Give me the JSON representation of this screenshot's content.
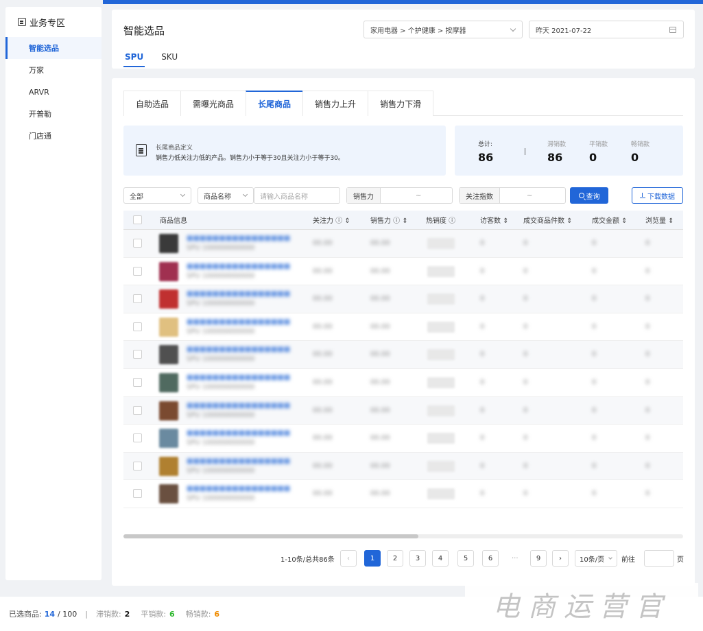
{
  "sidebar": {
    "title": "业务专区",
    "items": [
      {
        "label": "智能选品",
        "active": true
      },
      {
        "label": "万家",
        "active": false
      },
      {
        "label": "ARVR",
        "active": false
      },
      {
        "label": "开普勒",
        "active": false
      },
      {
        "label": "门店通",
        "active": false
      }
    ]
  },
  "header": {
    "title": "智能选品",
    "category": "家用电器 > 个护健康 > 按摩器",
    "date": "昨天 2021-07-22",
    "tabs": [
      "SPU",
      "SKU"
    ],
    "active_tab": "SPU"
  },
  "main": {
    "tabs": [
      "自助选品",
      "需曝光商品",
      "长尾商品",
      "销售力上升",
      "销售力下滑"
    ],
    "active_tab": "长尾商品",
    "info": {
      "title": "长尾商品定义",
      "desc": "销售力低关注力低的产品。销售力小于等于30且关注力小于等于30。"
    },
    "stats": {
      "total_label": "总计:",
      "total": "86",
      "stagnant_label": "滞销款",
      "stagnant": "86",
      "flat_label": "平销款",
      "flat": "0",
      "hot_label": "畅销款",
      "hot": "0"
    },
    "filters": {
      "scope": "全部",
      "field": "商品名称",
      "name_placeholder": "请输入商品名称",
      "sales_label": "销售力",
      "range_sep": "~",
      "attention_label": "关注指数",
      "query": "查询",
      "download": "下载数据"
    },
    "table": {
      "columns": [
        "商品信息",
        "关注力 ⓘ ⇕",
        "销售力 ⓘ ⇕",
        "热销度 ⓘ",
        "访客数 ⇕",
        "成交商品件数 ⇕",
        "成交金额 ⇕",
        "浏览量 ⇕"
      ],
      "rows": [
        {
          "name": "■■■■■■■■■■■■■■■■",
          "spu": "SPU 100000000000",
          "att": "00.00",
          "sales": "00.00",
          "heat": "■■■",
          "uv": "0",
          "qty": "0",
          "amt": "0",
          "pv": "0",
          "thumb": "#3a3a3a"
        },
        {
          "name": "■■■■■■■■■■■■■■■■",
          "spu": "SPU 100000000000",
          "att": "00.00",
          "sales": "00.00",
          "heat": "■■■",
          "uv": "0",
          "qty": "0",
          "amt": "0",
          "pv": "0",
          "thumb": "#a03050"
        },
        {
          "name": "■■■■■■■■■■■■■■■■",
          "spu": "SPU 100000000000",
          "att": "00.00",
          "sales": "00.00",
          "heat": "■■■",
          "uv": "0",
          "qty": "0",
          "amt": "0",
          "pv": "0",
          "thumb": "#c03030"
        },
        {
          "name": "■■■■■■■■■■■■■■■■",
          "spu": "SPU 100000000000",
          "att": "00.00",
          "sales": "00.00",
          "heat": "■■■",
          "uv": "0",
          "qty": "0",
          "amt": "0",
          "pv": "0",
          "thumb": "#e0c080"
        },
        {
          "name": "■■■■■■■■■■■■■■■■",
          "spu": "SPU 100000000000",
          "att": "00.00",
          "sales": "00.00",
          "heat": "■■■",
          "uv": "0",
          "qty": "0",
          "amt": "0",
          "pv": "0",
          "thumb": "#505050"
        },
        {
          "name": "■■■■■■■■■■■■■■■■",
          "spu": "SPU 100000000000",
          "att": "00.00",
          "sales": "00.00",
          "heat": "■■■",
          "uv": "0",
          "qty": "0",
          "amt": "0",
          "pv": "0",
          "thumb": "#506a60"
        },
        {
          "name": "■■■■■■■■■■■■■■■■",
          "spu": "SPU 100000000000",
          "att": "00.00",
          "sales": "00.00",
          "heat": "■■■",
          "uv": "0",
          "qty": "0",
          "amt": "0",
          "pv": "0",
          "thumb": "#7a4a30"
        },
        {
          "name": "■■■■■■■■■■■■■■■■",
          "spu": "SPU 100000000000",
          "att": "00.00",
          "sales": "00.00",
          "heat": "■■■",
          "uv": "0",
          "qty": "0",
          "amt": "0",
          "pv": "0",
          "thumb": "#6a8aa0"
        },
        {
          "name": "■■■■■■■■■■■■■■■■",
          "spu": "SPU 100000000000",
          "att": "00.00",
          "sales": "00.00",
          "heat": "■■■",
          "uv": "0",
          "qty": "0",
          "amt": "0",
          "pv": "0",
          "thumb": "#b08030"
        },
        {
          "name": "■■■■■■■■■■■■■■■■",
          "spu": "SPU 100000000000",
          "att": "00.00",
          "sales": "00.00",
          "heat": "■■■",
          "uv": "0",
          "qty": "0",
          "amt": "0",
          "pv": "0",
          "thumb": "#6a5040"
        }
      ]
    },
    "pagination": {
      "summary": "1-10条/总共86条",
      "prev": "‹",
      "pages": [
        "1",
        "2",
        "3",
        "4",
        "5",
        "6"
      ],
      "ellipsis": "···",
      "last": "9",
      "next": "›",
      "page_size": "10条/页",
      "jump_label": "前往",
      "page_unit": "页"
    }
  },
  "footer": {
    "selected_label": "已选商品:",
    "selected": "14",
    "selected_total": "/ 100",
    "sep": "|",
    "stagnant_label": "滞销款:",
    "stagnant": "2",
    "flat_label": "平销款:",
    "flat": "6",
    "hot_label": "畅销款:",
    "hot": "6"
  },
  "watermark": "电商运营官",
  "colors": {
    "primary": "#2166d8",
    "flat": "#2eb82e",
    "hot": "#f08c00"
  }
}
